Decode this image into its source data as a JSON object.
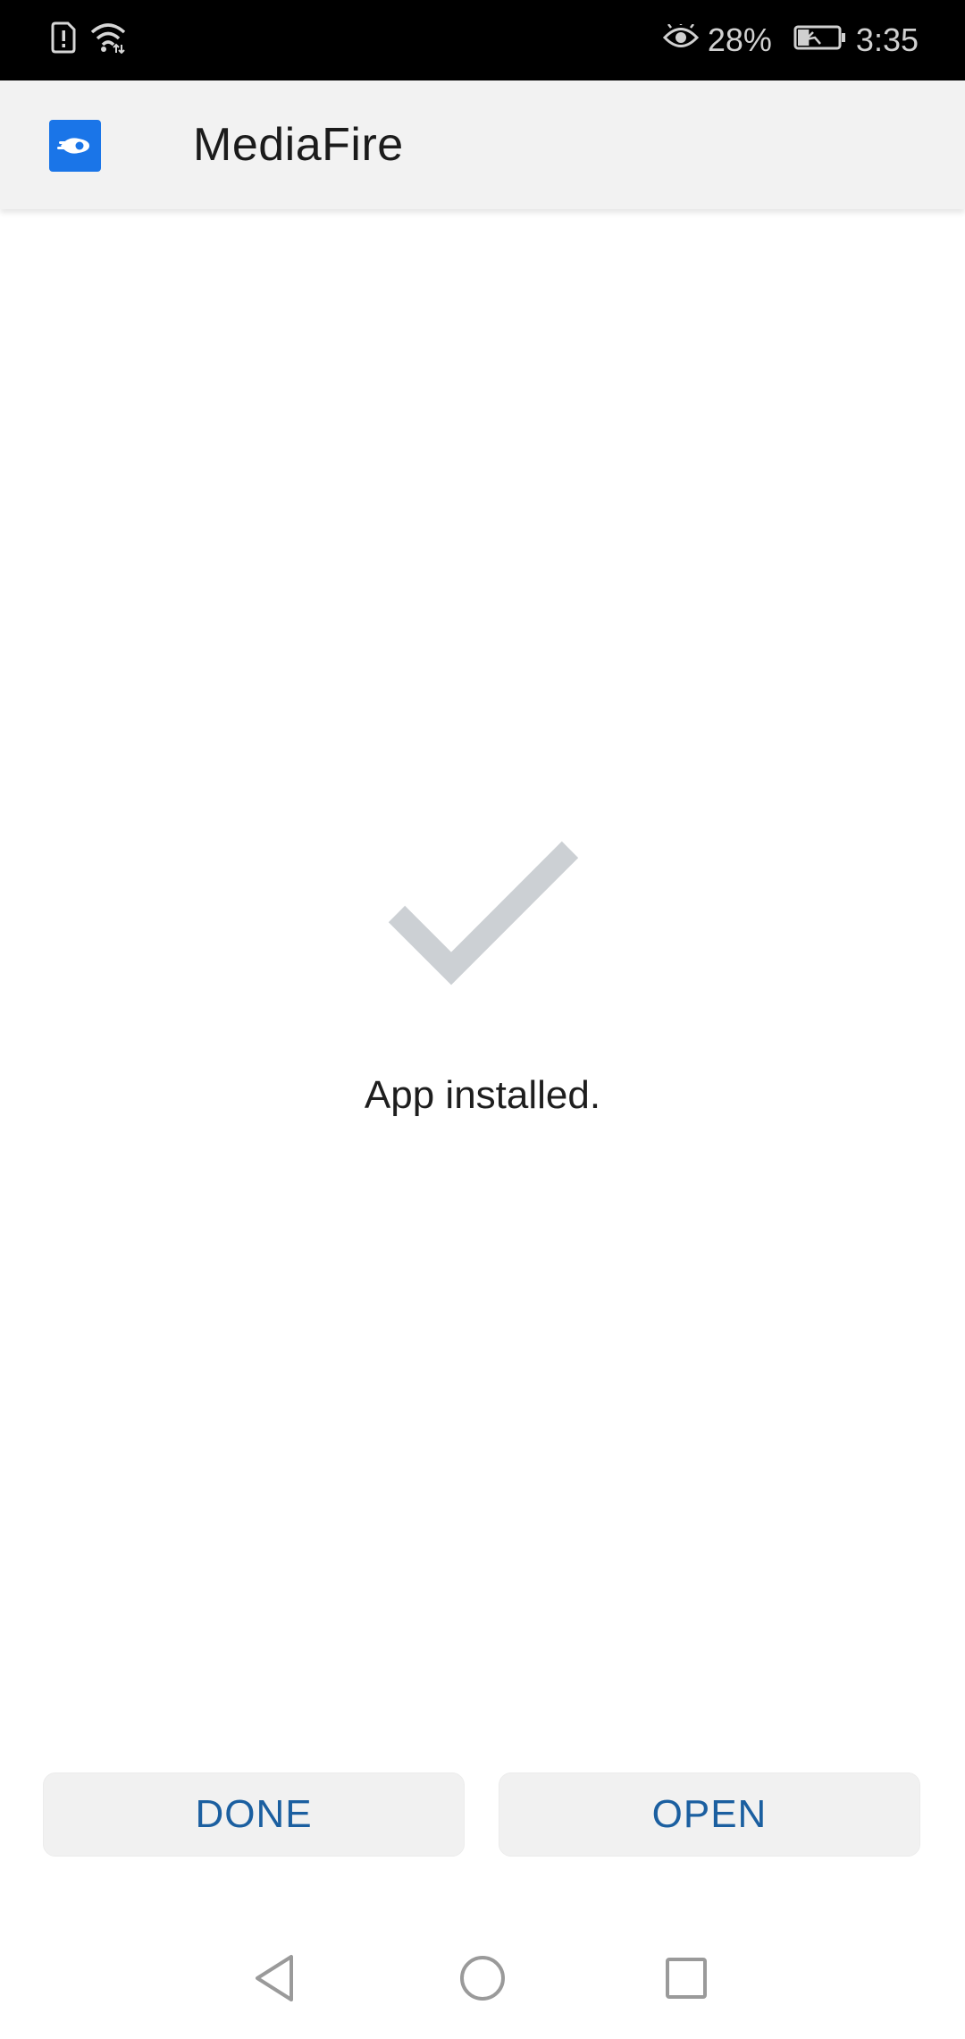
{
  "status_bar": {
    "battery_percent": "28%",
    "battery_level": 0.28,
    "time": "3:35",
    "icons": [
      "sim-alert-icon",
      "wifi-icon",
      "eye-comfort-icon",
      "battery-charging-icon"
    ]
  },
  "app_bar": {
    "title": "MediaFire",
    "icon": "mediafire-logo-icon",
    "accent_color": "#1a75e8"
  },
  "content": {
    "status_icon": "checkmark-icon",
    "message": "App installed."
  },
  "actions": {
    "done_label": "DONE",
    "open_label": "OPEN",
    "label_color": "#1b5fa0"
  },
  "nav_bar": {
    "icons": [
      "back-icon",
      "home-icon",
      "recents-icon"
    ]
  }
}
